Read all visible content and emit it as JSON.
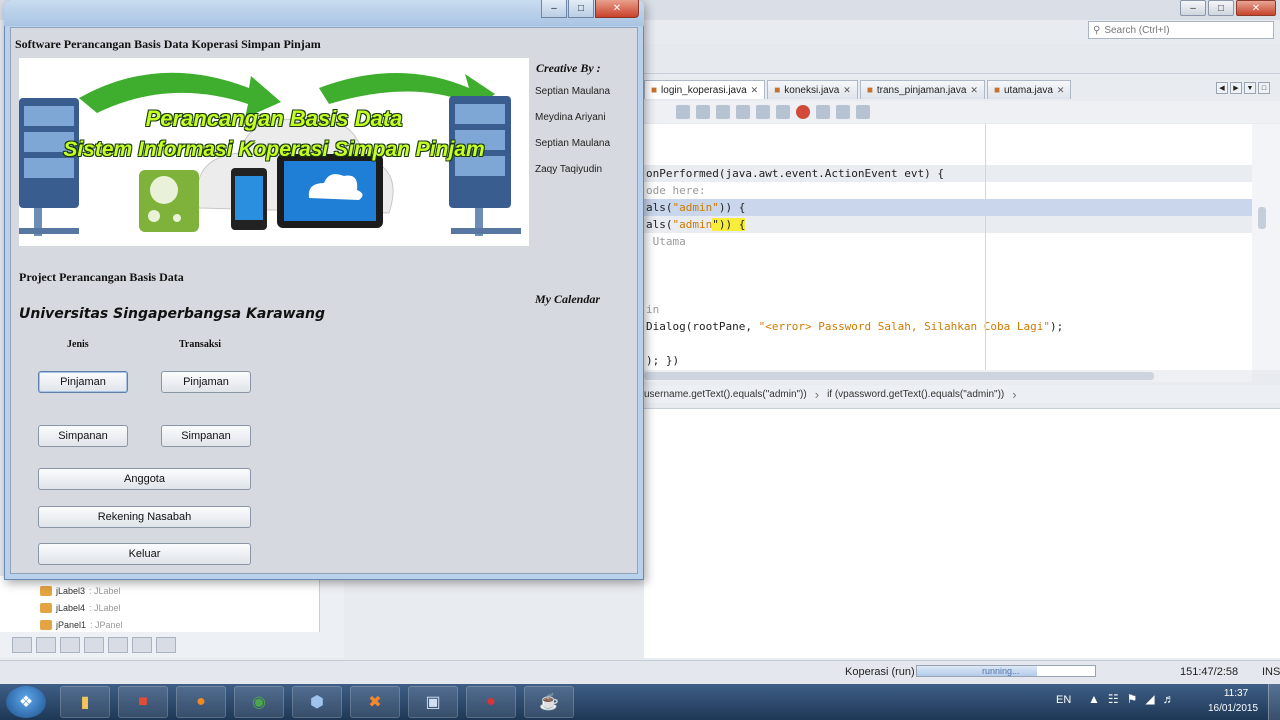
{
  "ide": {
    "search_placeholder": "Search (Ctrl+I)",
    "tabs": [
      {
        "label": "login_koperasi.java"
      },
      {
        "label": "koneksi.java"
      },
      {
        "label": "trans_pinjaman.java"
      },
      {
        "label": "utama.java"
      }
    ],
    "code_lines": [
      {
        "pre": "onPerformed(java.awt.event.ActionEvent evt) {",
        "str": "",
        "post": ""
      },
      {
        "pre": "ode here:",
        "str": "",
        "post": ""
      },
      {
        "pre": "als(",
        "str": "\"admin\"",
        "post": ")) {"
      },
      {
        "pre": "als(",
        "str": "\"admin",
        "post": "\")) {"
      },
      {
        "pre": " Utama",
        "str": "",
        "post": ""
      },
      {
        "pre": "in",
        "str": "",
        "post": ""
      },
      {
        "pre": "Dialog(rootPane, ",
        "str": "\"<error> Password Salah, Silahkan Coba Lagi\"",
        "post": ");"
      },
      {
        "pre": "); })",
        "str": "",
        "post": ""
      }
    ],
    "breadcrumbs": [
      "username.getText().equals(\"admin\"))",
      "if (vpassword.getText().equals(\"admin\"))"
    ],
    "navigator_items": [
      {
        "name": "jLabel3",
        "type": ": JLabel"
      },
      {
        "name": "jLabel4",
        "type": ": JLabel"
      },
      {
        "name": "jPanel1",
        "type": ": JPanel"
      }
    ],
    "status": {
      "project": "Koperasi (run)",
      "running": "running...",
      "position": "151:47/2:58",
      "mode": "INS"
    }
  },
  "taskbar": {
    "lang": "EN",
    "time": "11:37",
    "date": "16/01/2015"
  },
  "app": {
    "title": "Software Perancangan Basis Data Koperasi Simpan Pinjam",
    "banner_line1": "Perancangan Basis Data",
    "banner_line2": "Sistem Informasi Koperasi Simpan Pinjam",
    "creative_by": "Creative By :",
    "creators": [
      "Septian Maulana",
      "Meydina Ariyani",
      "Septian Maulana",
      "Zaqy Taqiyudin"
    ],
    "project_label": "Project Perancangan Basis Data",
    "university": "Universitas Singaperbangsa Karawang",
    "my_calendar": "My Calendar",
    "jenis_label": "Jenis",
    "transaksi_label": "Transaksi",
    "buttons": {
      "jenis_pinjaman": "Pinjaman",
      "transaksi_pinjaman": "Pinjaman",
      "jenis_simpanan": "Simpanan",
      "transaksi_simpanan": "Simpanan",
      "anggota": "Anggota",
      "rekening_nasabah": "Rekening Nasabah",
      "keluar": "Keluar"
    }
  }
}
